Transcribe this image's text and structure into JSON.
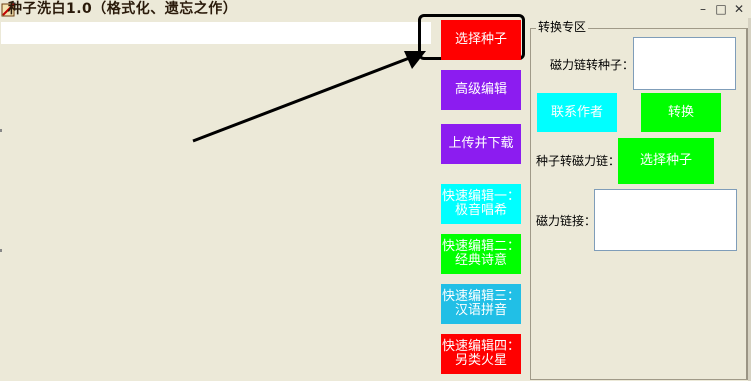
{
  "window": {
    "title": "种子洗白1.0（格式化、遗忘之作）",
    "controls": {
      "minimize": "–",
      "maximize": "□",
      "close": "✕"
    }
  },
  "url_input": {
    "value": "",
    "placeholder": ""
  },
  "buttons": {
    "select_seed": "选择种子",
    "advanced_edit": "高级编辑",
    "upload_download": "上传并下载",
    "quick1_line1": "快速编辑一：",
    "quick1_line2": "极音唱希",
    "quick2_line1": "快速编辑二：",
    "quick2_line2": "经典诗意",
    "quick3_line1": "快速编辑三：",
    "quick3_line2": "汉语拼音",
    "quick4_line1": "快速编辑四：",
    "quick4_line2": "另类火星"
  },
  "convert_panel": {
    "legend": "转换专区",
    "magnet_to_seed_label": "磁力链转种子：",
    "contact_author": "联系作者",
    "convert": "转换",
    "seed_to_magnet_label": "种子转磁力链：",
    "select_seed": "选择种子",
    "magnet_link_label": "磁力链接："
  },
  "colors": {
    "red": "#ff0000",
    "purple": "#8c1cf0",
    "cyan": "#00ffff",
    "green": "#00ff00",
    "teal": "#21bfe6",
    "background": "#ece9d8"
  }
}
